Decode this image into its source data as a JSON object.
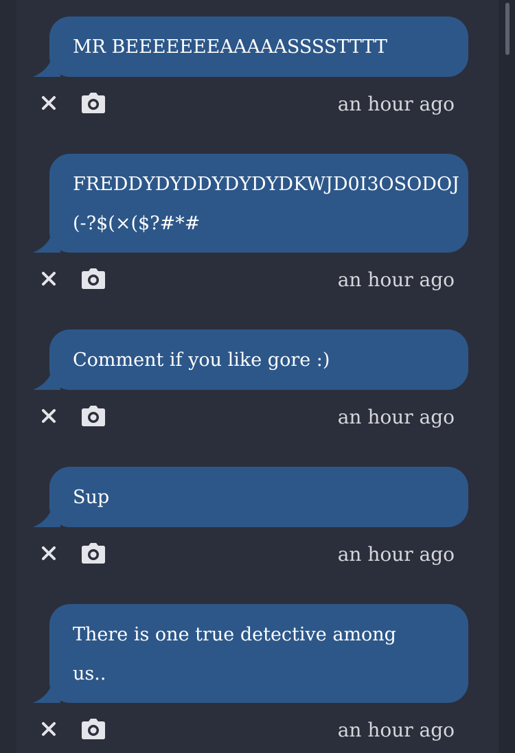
{
  "colors": {
    "background": "#262b35",
    "feed": "#2b2f3b",
    "bubble": "#2d5789",
    "text": "#ffffff",
    "muted_text": "#d6d7dc"
  },
  "icons": {
    "delete": "close-icon",
    "screenshot": "camera-icon"
  },
  "messages": [
    {
      "text_lines": [
        "MR BEEEEEEEAAAAASSSSTTTT"
      ],
      "timestamp": "an hour ago"
    },
    {
      "text_lines": [
        "FREDDYDYDDYDYDYDKWJD0I3OSODOJ",
        "(-?$(×($?#*#"
      ],
      "timestamp": "an hour ago"
    },
    {
      "text_lines": [
        "Comment if you like gore :)"
      ],
      "timestamp": "an hour ago"
    },
    {
      "text_lines": [
        "Sup"
      ],
      "timestamp": "an hour ago"
    },
    {
      "text_lines": [
        "There is one true detective among",
        "us.."
      ],
      "timestamp": "an hour ago"
    }
  ]
}
